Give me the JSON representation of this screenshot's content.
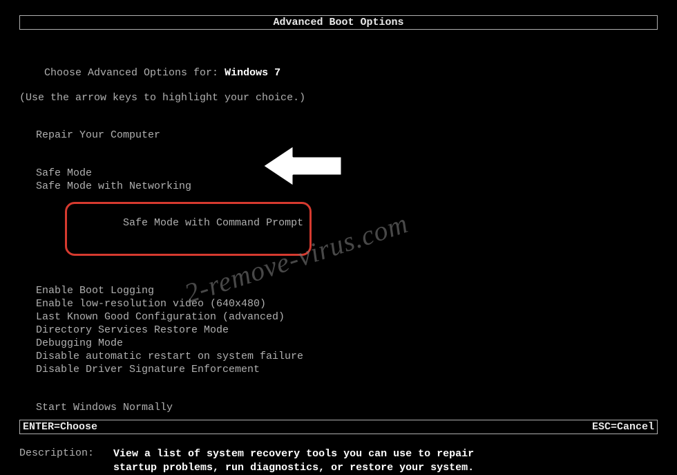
{
  "title": "Advanced Boot Options",
  "prompt": {
    "prefix": "Choose Advanced Options for: ",
    "os": "Windows 7",
    "hint": "(Use the arrow keys to highlight your choice.)"
  },
  "groups": {
    "repair": [
      "Repair Your Computer"
    ],
    "safe": [
      "Safe Mode",
      "Safe Mode with Networking",
      "Safe Mode with Command Prompt"
    ],
    "advanced": [
      "Enable Boot Logging",
      "Enable low-resolution video (640x480)",
      "Last Known Good Configuration (advanced)",
      "Directory Services Restore Mode",
      "Debugging Mode",
      "Disable automatic restart on system failure",
      "Disable Driver Signature Enforcement"
    ],
    "normal": [
      "Start Windows Normally"
    ]
  },
  "highlighted_option": "Safe Mode with Command Prompt",
  "description": {
    "label": "Description:",
    "text": "View a list of system recovery tools you can use to repair startup problems, run diagnostics, or restore your system."
  },
  "footer": {
    "enter": "ENTER=Choose",
    "esc": "ESC=Cancel"
  },
  "watermark": "2-remove-virus.com",
  "annotation": {
    "arrow_points_to": "Safe Mode with Command Prompt",
    "ring_color": "#d63a2f"
  }
}
